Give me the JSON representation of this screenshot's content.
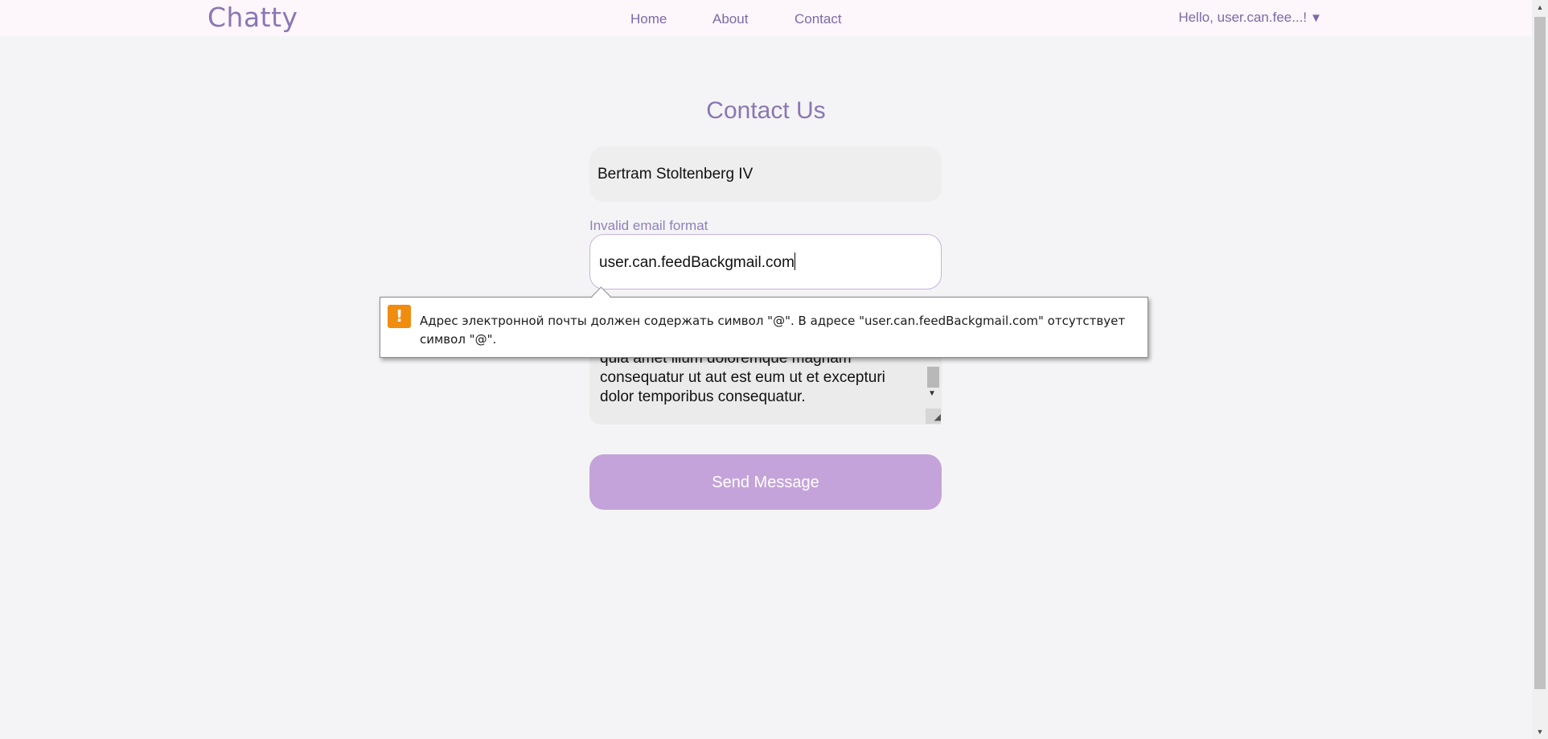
{
  "header": {
    "logo": "Chatty",
    "nav": [
      {
        "label": "Home"
      },
      {
        "label": "About"
      },
      {
        "label": "Contact"
      }
    ],
    "user_greeting": "Hello, user.can.fee...!",
    "user_caret": "▼"
  },
  "form": {
    "title": "Contact Us",
    "name_value": "Bertram Stoltenberg IV",
    "email_error": "Invalid email format",
    "email_value": "user.can.feedBackgmail.com",
    "message_value": "voluptatem vitae praesentium amet minima in quia amet illum doloremque magnam consequatur ut aut est eum ut et excepturi dolor temporibus consequatur.",
    "send_label": "Send Message"
  },
  "tooltip": {
    "icon": "!",
    "message": "Адрес электронной почты должен содержать символ \"@\". В адресе \"user.can.feedBackgmail.com\" отсутствует символ \"@\"."
  },
  "colors": {
    "accent": "#8a76b4",
    "button": "#c4a3da",
    "warning": "#f08c10"
  }
}
